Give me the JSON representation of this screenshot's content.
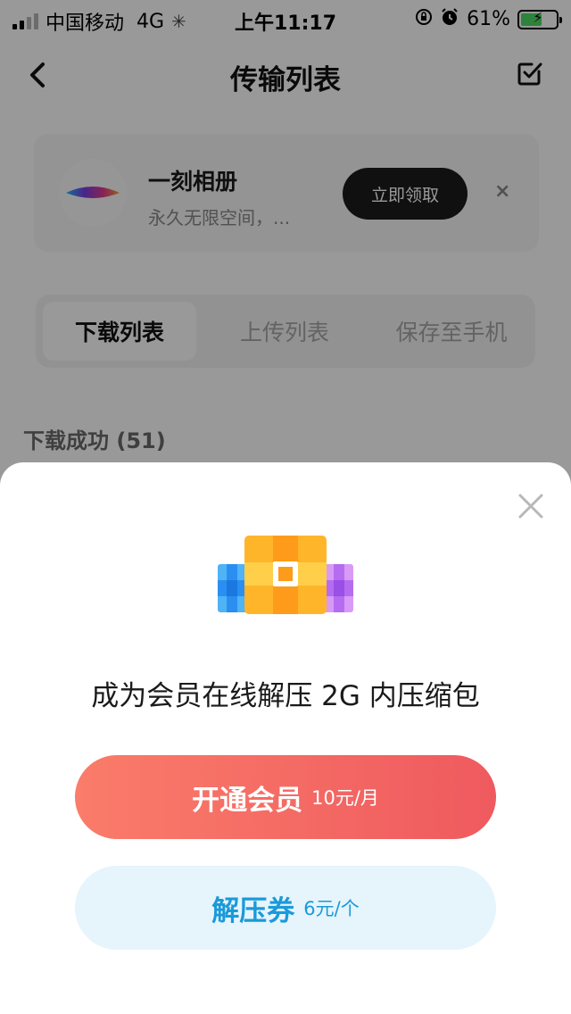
{
  "status_bar": {
    "carrier": "中国移动",
    "network": "4G",
    "time": "上午11:17",
    "battery": "61%",
    "battery_level": 0.61
  },
  "nav": {
    "title": "传输列表",
    "back_icon": "chevron-left-icon",
    "edit_icon": "checkbox-edit-icon"
  },
  "promo": {
    "title": "一刻相册",
    "subtitle": "永久无限空间，...",
    "button": "立即领取",
    "close": "×"
  },
  "tabs": [
    {
      "label": "下载列表",
      "active": true
    },
    {
      "label": "上传列表",
      "active": false
    },
    {
      "label": "保存至手机",
      "active": false
    }
  ],
  "section": {
    "title": "下载成功 (51)"
  },
  "sheet": {
    "icon": "archive-package-icon",
    "title": "成为会员在线解压 2G 内压缩包",
    "vip_button": {
      "label": "开通会员",
      "price": "10元/月"
    },
    "ticket_button": {
      "label": "解压券",
      "price": "6元/个"
    },
    "colors": {
      "vip_start": "#fa7c6a",
      "vip_end": "#ef5a5f",
      "ticket_bg": "#e6f4fc",
      "ticket_text": "#1a9ad9"
    }
  }
}
